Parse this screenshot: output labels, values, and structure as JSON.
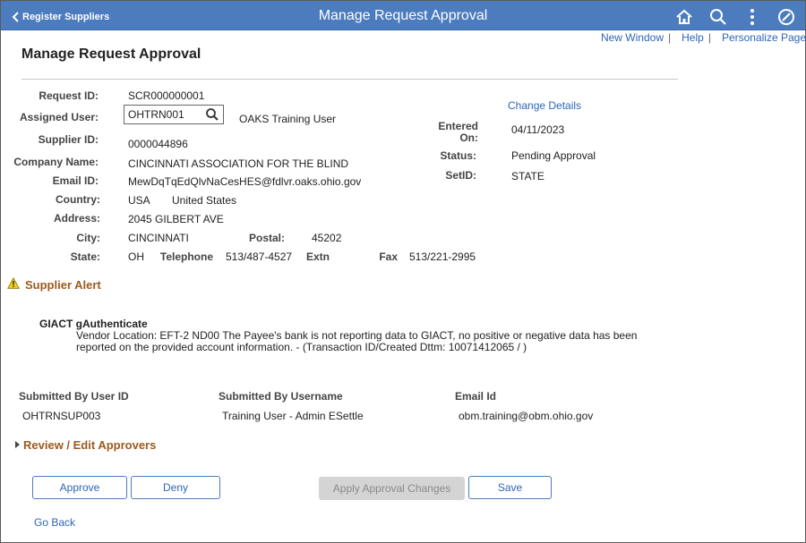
{
  "header": {
    "back_label": "Register Suppliers",
    "title": "Manage Request Approval",
    "icons": [
      "home-icon",
      "search-icon",
      "more-vertical-icon",
      "navbar-compass-icon"
    ]
  },
  "toplinks": {
    "new_window": "New Window",
    "help": "Help",
    "personalize": "Personalize Page"
  },
  "page": {
    "title": "Manage Request Approval"
  },
  "request": {
    "request_id_label": "Request ID:",
    "request_id": "SCR000000001",
    "assigned_user_label": "Assigned User:",
    "assigned_user": "OHTRN001",
    "assigned_user_name": "OAKS Training User",
    "supplier_id_label": "Supplier ID:",
    "supplier_id": "0000044896",
    "company_label": "Company Name:",
    "company": "CINCINNATI ASSOCIATION FOR THE BLIND",
    "email_label": "Email ID:",
    "email": "MewDqTqEdQlvNaCesHES@fdlvr.oaks.ohio.gov",
    "country_label": "Country:",
    "country_code": "USA",
    "country_name": "United States",
    "address_label": "Address:",
    "address": "2045 GILBERT AVE",
    "city_label": "City:",
    "city": "CINCINNATI",
    "postal_label": "Postal:",
    "postal": "45202",
    "state_label": "State:",
    "state": "OH",
    "telephone_label": "Telephone",
    "telephone": "513/487-4527",
    "extn_label": "Extn",
    "fax_label": "Fax",
    "fax": "513/221-2995"
  },
  "details": {
    "change_details": "Change Details",
    "entered_on_label_1": "Entered",
    "entered_on_label_2": "On:",
    "entered_on": "04/11/2023",
    "status_label": "Status:",
    "status": "Pending Approval",
    "setid_label": "SetID:",
    "setid": "STATE"
  },
  "alert": {
    "section_title": "Supplier Alert",
    "title": "GIACT gAuthenticate",
    "body": "Vendor Location: EFT-2 ND00 The Payee's bank is not reporting data to GIACT, no positive or negative data has been reported on the provided account information. - (Transaction ID/Created Dttm: 10071412065 / )"
  },
  "submitter": {
    "user_id_label": "Submitted By User ID",
    "user_id": "OHTRNSUP003",
    "username_label": "Submitted By Username",
    "username": "Training User - Admin ESettle",
    "email_label": "Email Id",
    "email": "obm.training@obm.ohio.gov"
  },
  "approvers": {
    "section_title": "Review / Edit Approvers"
  },
  "buttons": {
    "approve": "Approve",
    "deny": "Deny",
    "apply": "Apply Approval Changes",
    "save": "Save"
  },
  "footer": {
    "go_back": "Go Back"
  },
  "colors": {
    "header_bg": "#4d7cbe",
    "link": "#2e66b6",
    "section_header": "#9c5a1e",
    "warning": "#f2d21b"
  }
}
